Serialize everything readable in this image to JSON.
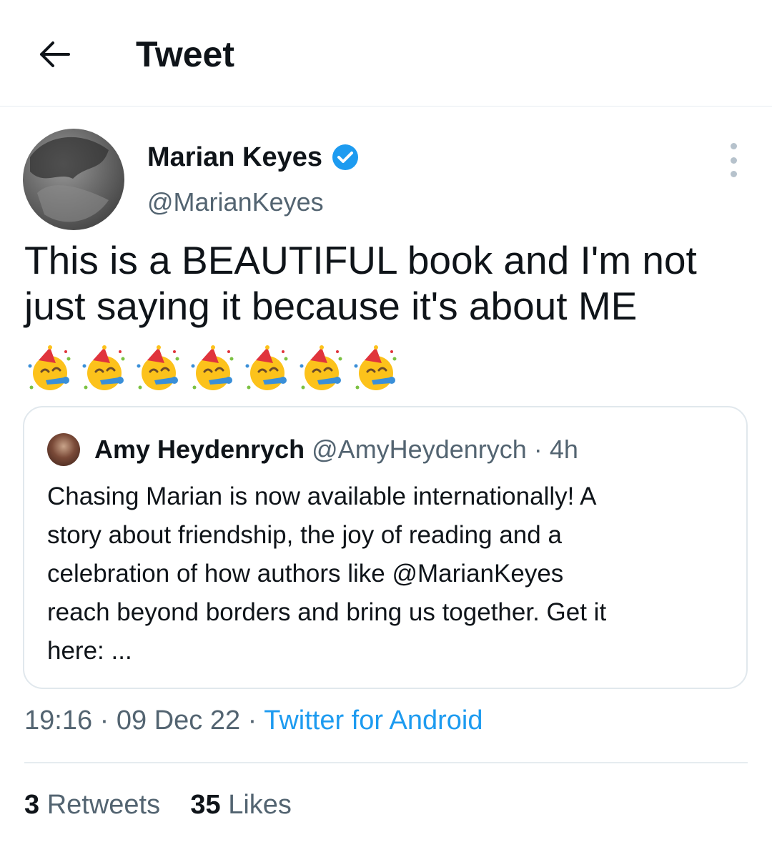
{
  "header": {
    "title": "Tweet"
  },
  "tweet": {
    "author_name": "Marian Keyes",
    "author_handle": "@MarianKeyes",
    "text": "This is a BEAUTIFUL book and I'm not just saying it because it's about ME",
    "emojis": [
      "partying-face-icon",
      "partying-face-icon",
      "partying-face-icon",
      "partying-face-icon",
      "partying-face-icon",
      "partying-face-icon",
      "partying-face-icon"
    ],
    "time": "19:16",
    "date": "09 Dec 22",
    "source": "Twitter for Android",
    "separator": "·"
  },
  "quote": {
    "author_name": "Amy Heydenrych",
    "author_handle": "@AmyHeydenrych",
    "separator": "·",
    "time": "4h",
    "text": "Chasing Marian is now available internationally! A\nstory about friendship, the joy of reading and a\ncelebration of how authors like @MarianKeyes\nreach beyond borders and bring us together. Get it\nhere: ..."
  },
  "stats": {
    "retweets_count": "3",
    "retweets_label": "Retweets",
    "likes_count": "35",
    "likes_label": "Likes"
  },
  "colors": {
    "accent": "#1d9bf0",
    "secondary_text": "#536471",
    "border": "#e6ecf0"
  }
}
